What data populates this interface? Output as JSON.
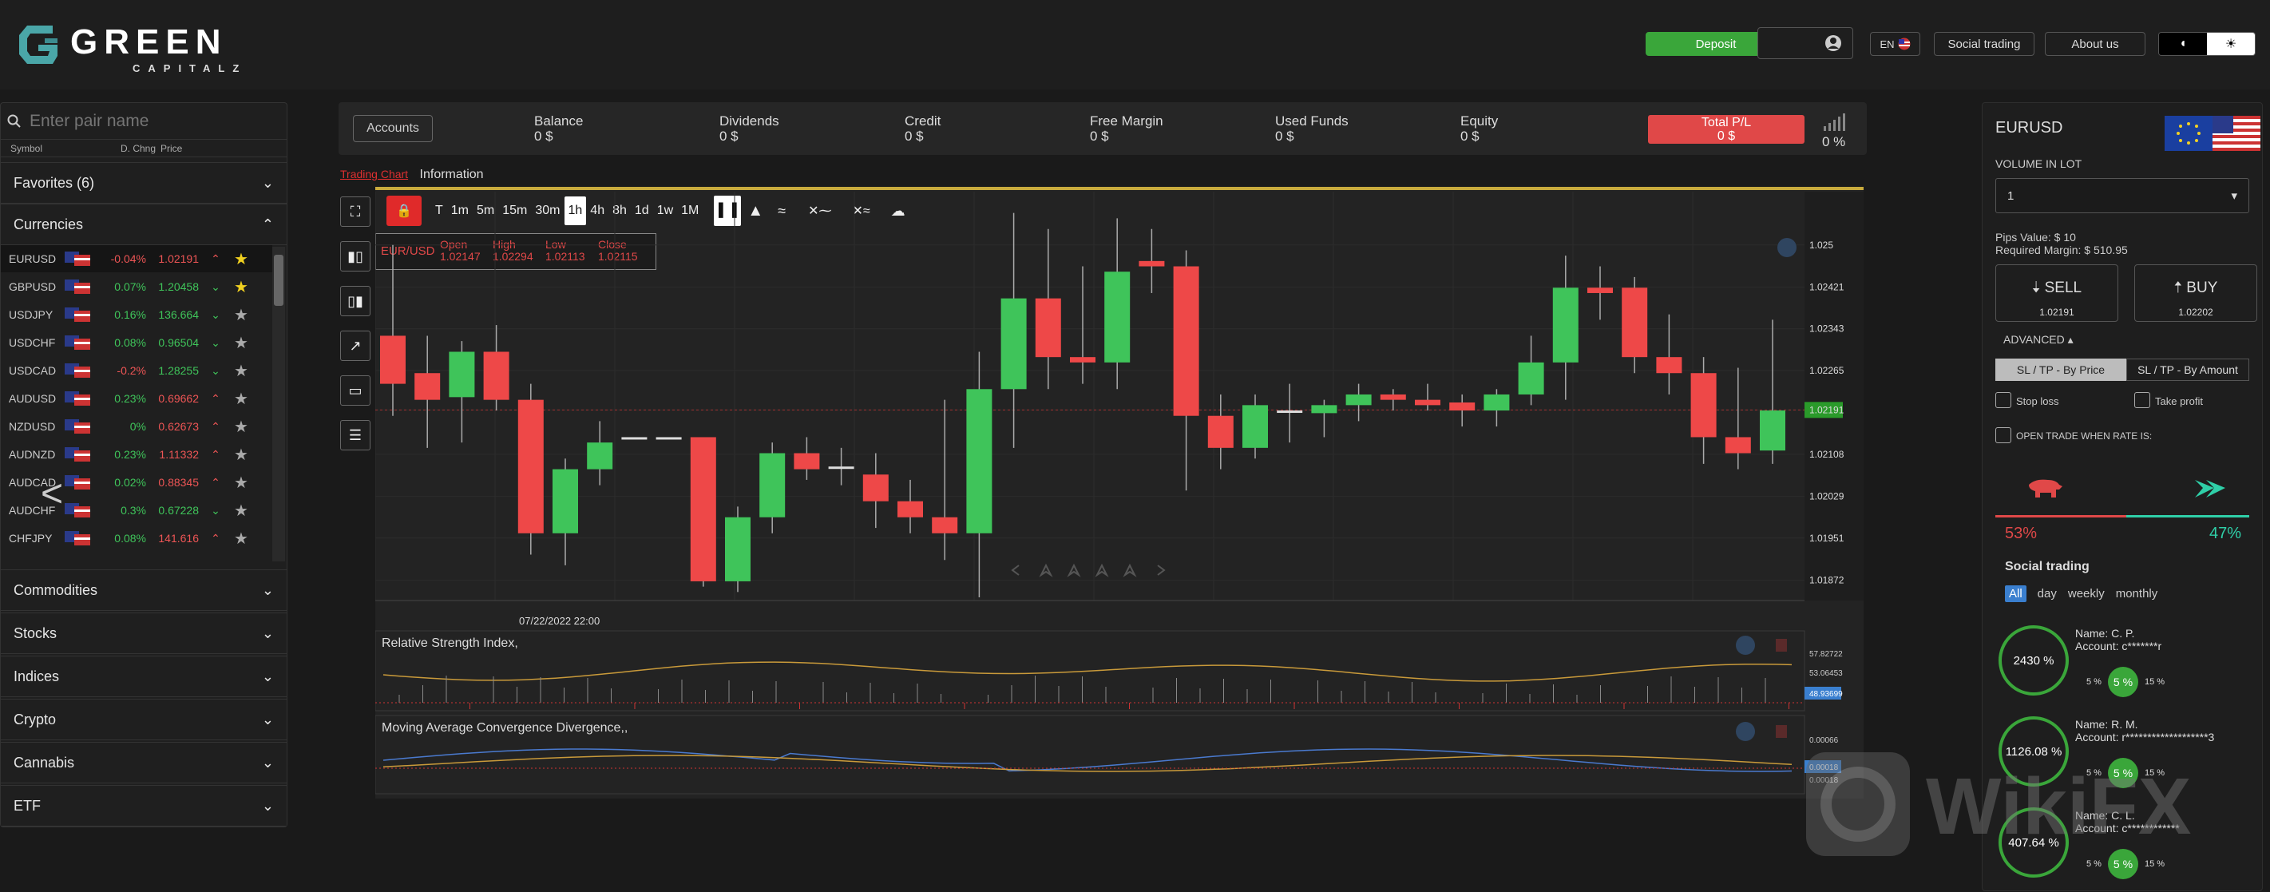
{
  "brand": {
    "name": "GREEN",
    "sub": "CAPITALZ"
  },
  "header": {
    "deposit": "Deposit",
    "lang": "EN",
    "social": "Social trading",
    "about": "About us"
  },
  "sidebar": {
    "search_placeholder": "Enter pair name",
    "cols": {
      "symbol": "Symbol",
      "chng": "D. Chng",
      "price": "Price"
    },
    "favorites": "Favorites (6)",
    "currencies": "Currencies",
    "pairs": [
      {
        "sym": "EURUSD",
        "chg": "-0.04%",
        "price": "1.02191",
        "dir": "dn",
        "arrow": "^",
        "starred": true
      },
      {
        "sym": "GBPUSD",
        "chg": "0.07%",
        "price": "1.20458",
        "dir": "up",
        "arrow": "v",
        "starred": true
      },
      {
        "sym": "USDJPY",
        "chg": "0.16%",
        "price": "136.664",
        "dir": "up",
        "arrow": "v",
        "starred": false
      },
      {
        "sym": "USDCHF",
        "chg": "0.08%",
        "price": "0.96504",
        "dir": "up",
        "arrow": "v",
        "starred": false
      },
      {
        "sym": "USDCAD",
        "chg": "-0.2%",
        "price": "1.28255",
        "dir": "up",
        "arrow": "v",
        "starred": false
      },
      {
        "sym": "AUDUSD",
        "chg": "0.23%",
        "price": "0.69662",
        "dir": "dn",
        "arrow": "^",
        "starred": false
      },
      {
        "sym": "NZDUSD",
        "chg": "0%",
        "price": "0.62673",
        "dir": "dn",
        "arrow": "^",
        "starred": false
      },
      {
        "sym": "AUDNZD",
        "chg": "0.23%",
        "price": "1.11332",
        "dir": "dn",
        "arrow": "^",
        "starred": false
      },
      {
        "sym": "AUDCAD",
        "chg": "0.02%",
        "price": "0.88345",
        "dir": "dn",
        "arrow": "^",
        "starred": false
      },
      {
        "sym": "AUDCHF",
        "chg": "0.3%",
        "price": "0.67228",
        "dir": "up",
        "arrow": "v",
        "starred": false
      },
      {
        "sym": "CHFJPY",
        "chg": "0.08%",
        "price": "141.616",
        "dir": "dn",
        "arrow": "^",
        "starred": false
      }
    ],
    "groups": [
      "Commodities",
      "Stocks",
      "Indices",
      "Crypto",
      "Cannabis",
      "ETF"
    ]
  },
  "stats": {
    "accounts": "Accounts",
    "items": [
      {
        "label": "Balance",
        "value": "0 $"
      },
      {
        "label": "Dividends",
        "value": "0 $"
      },
      {
        "label": "Credit",
        "value": "0 $"
      },
      {
        "label": "Free Margin",
        "value": "0 $"
      },
      {
        "label": "Used Funds",
        "value": "0 $"
      },
      {
        "label": "Equity",
        "value": "0 $"
      }
    ],
    "total_label": "Total P/L",
    "total_value": "0 $",
    "signal": "0 %"
  },
  "chart": {
    "tabs": {
      "trading": "Trading Chart",
      "info": "Information"
    },
    "timeframes": [
      "T",
      "1m",
      "5m",
      "15m",
      "30m",
      "1h",
      "4h",
      "8h",
      "1d",
      "1w",
      "1M"
    ],
    "selected_tf": "1h",
    "ohlc": {
      "pair": "EUR/USD",
      "open_l": "Open",
      "high_l": "High",
      "low_l": "Low",
      "close_l": "Close",
      "open": "1.02147",
      "high": "1.02294",
      "low": "1.02113",
      "close": "1.02115"
    },
    "date_label": "07/22/2022 22:00",
    "yticks": [
      "1.025",
      "1.02421",
      "1.02343",
      "1.02265",
      "1.02191",
      "1.02108",
      "1.02029",
      "1.01951",
      "1.01872"
    ],
    "current_price": "1.02191",
    "rsi_title": "Relative Strength Index,",
    "rsi_ticks": [
      "57.82722",
      "53.06453",
      "48.93699"
    ],
    "macd_title": "Moving Average Convergence Divergence,,",
    "macd_ticks": [
      "0.00066",
      "0.00018",
      "0.00018"
    ]
  },
  "chart_data": {
    "type": "candlestick",
    "pair": "EUR/USD",
    "candles": [
      {
        "o": 1.0233,
        "h": 1.025,
        "l": 1.0218,
        "c": 1.0224
      },
      {
        "o": 1.0226,
        "h": 1.0233,
        "l": 1.0212,
        "c": 1.0221
      },
      {
        "o": 1.02215,
        "h": 1.0232,
        "l": 1.0213,
        "c": 1.023
      },
      {
        "o": 1.023,
        "h": 1.0235,
        "l": 1.0219,
        "c": 1.0221
      },
      {
        "o": 1.0221,
        "h": 1.0224,
        "l": 1.0192,
        "c": 1.0196
      },
      {
        "o": 1.0196,
        "h": 1.021,
        "l": 1.019,
        "c": 1.0208
      },
      {
        "o": 1.0208,
        "h": 1.0217,
        "l": 1.0205,
        "c": 1.0213
      },
      {
        "o": 1.0214,
        "h": 1.0214,
        "l": 1.0214,
        "c": 1.0214
      },
      {
        "o": 1.0214,
        "h": 1.0214,
        "l": 1.0214,
        "c": 1.0214
      },
      {
        "o": 1.0214,
        "h": 1.0214,
        "l": 1.0186,
        "c": 1.0187
      },
      {
        "o": 1.0187,
        "h": 1.0201,
        "l": 1.0185,
        "c": 1.0199
      },
      {
        "o": 1.0199,
        "h": 1.0213,
        "l": 1.0196,
        "c": 1.0211
      },
      {
        "o": 1.0211,
        "h": 1.0214,
        "l": 1.0206,
        "c": 1.0208
      },
      {
        "o": 1.02085,
        "h": 1.0212,
        "l": 1.0205,
        "c": 1.02085
      },
      {
        "o": 1.0207,
        "h": 1.0211,
        "l": 1.0197,
        "c": 1.0202
      },
      {
        "o": 1.0202,
        "h": 1.0206,
        "l": 1.0196,
        "c": 1.0199
      },
      {
        "o": 1.0199,
        "h": 1.0221,
        "l": 1.0191,
        "c": 1.0196
      },
      {
        "o": 1.0196,
        "h": 1.023,
        "l": 1.0184,
        "c": 1.0223
      },
      {
        "o": 1.0223,
        "h": 1.0256,
        "l": 1.0212,
        "c": 1.024
      },
      {
        "o": 1.024,
        "h": 1.0253,
        "l": 1.0223,
        "c": 1.0229
      },
      {
        "o": 1.0229,
        "h": 1.0246,
        "l": 1.0224,
        "c": 1.0228
      },
      {
        "o": 1.0228,
        "h": 1.0255,
        "l": 1.0223,
        "c": 1.0245
      },
      {
        "o": 1.0247,
        "h": 1.0253,
        "l": 1.0241,
        "c": 1.0246
      },
      {
        "o": 1.0246,
        "h": 1.0249,
        "l": 1.0204,
        "c": 1.0218
      },
      {
        "o": 1.0218,
        "h": 1.0222,
        "l": 1.0208,
        "c": 1.0212
      },
      {
        "o": 1.0212,
        "h": 1.0222,
        "l": 1.021,
        "c": 1.022
      },
      {
        "o": 1.0219,
        "h": 1.0224,
        "l": 1.0213,
        "c": 1.0219
      },
      {
        "o": 1.02185,
        "h": 1.0221,
        "l": 1.0214,
        "c": 1.022
      },
      {
        "o": 1.022,
        "h": 1.0224,
        "l": 1.0217,
        "c": 1.0222
      },
      {
        "o": 1.0222,
        "h": 1.0223,
        "l": 1.0219,
        "c": 1.0221
      },
      {
        "o": 1.0221,
        "h": 1.0224,
        "l": 1.0219,
        "c": 1.022
      },
      {
        "o": 1.02205,
        "h": 1.0222,
        "l": 1.0216,
        "c": 1.0219
      },
      {
        "o": 1.0219,
        "h": 1.0223,
        "l": 1.0216,
        "c": 1.0222
      },
      {
        "o": 1.0222,
        "h": 1.0233,
        "l": 1.022,
        "c": 1.0228
      },
      {
        "o": 1.0228,
        "h": 1.0248,
        "l": 1.0221,
        "c": 1.0242
      },
      {
        "o": 1.0242,
        "h": 1.0246,
        "l": 1.0236,
        "c": 1.0241
      },
      {
        "o": 1.0242,
        "h": 1.0244,
        "l": 1.0226,
        "c": 1.0229
      },
      {
        "o": 1.0229,
        "h": 1.0237,
        "l": 1.0222,
        "c": 1.0226
      },
      {
        "o": 1.0226,
        "h": 1.0229,
        "l": 1.0209,
        "c": 1.0214
      },
      {
        "o": 1.0214,
        "h": 1.0227,
        "l": 1.0208,
        "c": 1.0211
      },
      {
        "o": 1.02115,
        "h": 1.0236,
        "l": 1.0209,
        "c": 1.0219
      }
    ],
    "ylim": [
      1.0184,
      1.0257
    ]
  },
  "right": {
    "pair": "EURUSD",
    "vol_label": "VOLUME IN LOT",
    "vol_value": "1",
    "pips": "Pips Value: $ 10",
    "margin": "Required Margin: $ 510.95",
    "sell": "SELL",
    "sell_price": "1.02191",
    "buy": "BUY",
    "buy_price": "1.02202",
    "advanced": "ADVANCED",
    "sltp_price": "SL / TP - By Price",
    "sltp_amount": "SL / TP - By Amount",
    "stop_loss": "Stop loss",
    "take_profit": "Take profit",
    "open_when": "OPEN TRADE WHEN RATE IS:",
    "bear_pct": "53%",
    "bull_pct": "47%",
    "social_title": "Social trading",
    "periods": [
      "All",
      "day",
      "weekly",
      "monthly"
    ],
    "traders": [
      {
        "pct": "2430 %",
        "name": "Name: C. P.",
        "account": "Account: c*******r",
        "a": "5 %",
        "b": "5 %",
        "c": "15 %"
      },
      {
        "pct": "1126.08 %",
        "name": "Name: R. M.",
        "account": "Account: r*******************3",
        "a": "5 %",
        "b": "5 %",
        "c": "15 %"
      },
      {
        "pct": "407.64 %",
        "name": "Name: C. L.",
        "account": "Account: c************",
        "a": "5 %",
        "b": "5 %",
        "c": "15 %"
      }
    ]
  },
  "watermark": "WikiFX",
  "colors": {
    "up": "#3fc45a",
    "down": "#ee4848",
    "accent": "#c9ab3d",
    "green": "#3aa63a"
  }
}
